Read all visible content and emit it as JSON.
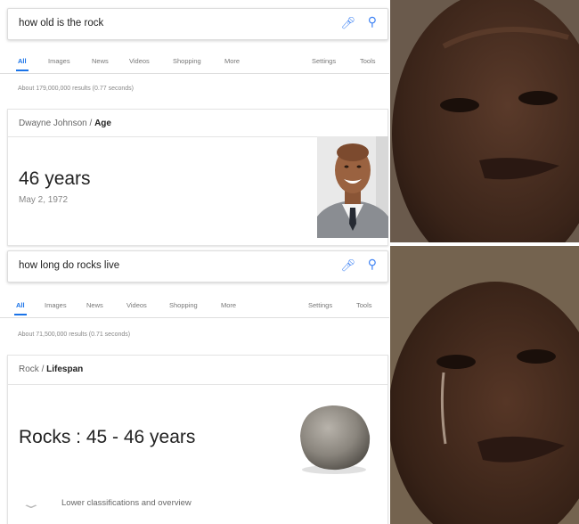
{
  "panel_top": {
    "search": {
      "query": "how old is the rock"
    },
    "tabs": [
      "All",
      "Images",
      "News",
      "Videos",
      "Shopping",
      "More",
      "Settings",
      "Tools"
    ],
    "stats": "About 179,000,000 results (0.77 seconds)",
    "card": {
      "crumb_subject": "Dwayne Johnson",
      "crumb_sep": " / ",
      "crumb_attr": "Age",
      "answer": "46 years",
      "sub": "May 2, 1972"
    }
  },
  "panel_bottom": {
    "search": {
      "query": "how long do rocks live"
    },
    "tabs": [
      "All",
      "Images",
      "News",
      "Videos",
      "Shopping",
      "More",
      "Settings",
      "Tools"
    ],
    "stats": "About 71,500,000 results (0.71 seconds)",
    "card": {
      "crumb_subject": "Rock",
      "crumb_sep": " / ",
      "crumb_attr": "Lifespan",
      "answer": "Rocks : 45 - 46 years",
      "lower": "Lower classifications and overview"
    }
  },
  "icons": {
    "mic": "microphone-icon",
    "search": "magnifier-icon"
  },
  "colors": {
    "accent": "#1a73e8",
    "mic": "#4285f4"
  }
}
